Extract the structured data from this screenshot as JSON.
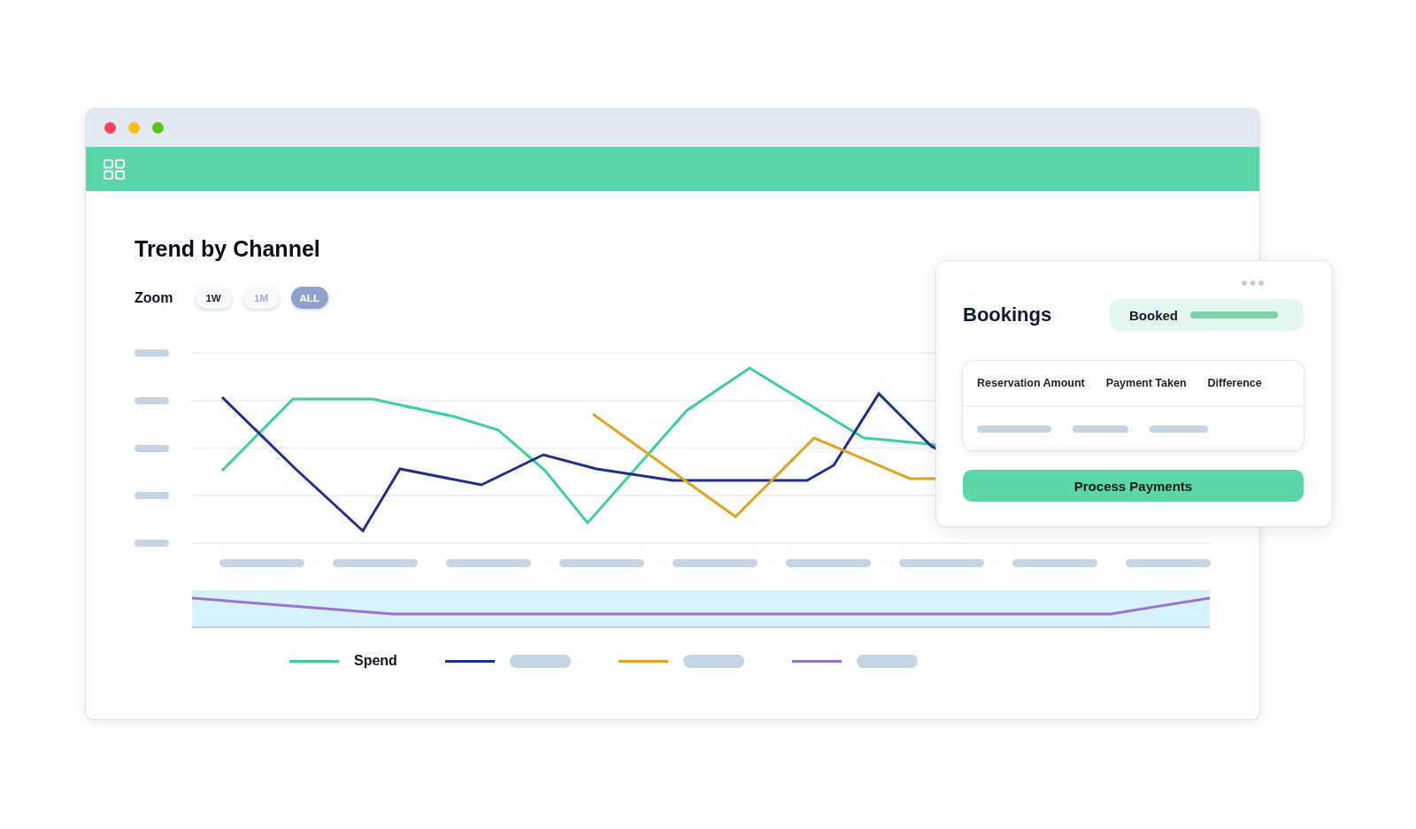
{
  "chart_panel": {
    "title": "Trend by Channel",
    "zoom": {
      "label": "Zoom",
      "options": [
        {
          "label": "1W",
          "selected": false,
          "disabled": false
        },
        {
          "label": "1M",
          "selected": false,
          "disabled": true
        },
        {
          "label": "ALL",
          "selected": true,
          "disabled": false
        }
      ]
    },
    "legend": [
      {
        "label": "Spend",
        "color": "#3ecf9b"
      },
      {
        "color": "#1f2f8c"
      },
      {
        "color": "#e3a124"
      },
      {
        "color": "#9a72d1"
      }
    ]
  },
  "bookings_card": {
    "title": "Bookings",
    "status": {
      "label": "Booked"
    },
    "table": {
      "columns": [
        "Reservation Amount",
        "Payment Taken",
        "Difference"
      ]
    },
    "button": "Process Payments"
  }
}
